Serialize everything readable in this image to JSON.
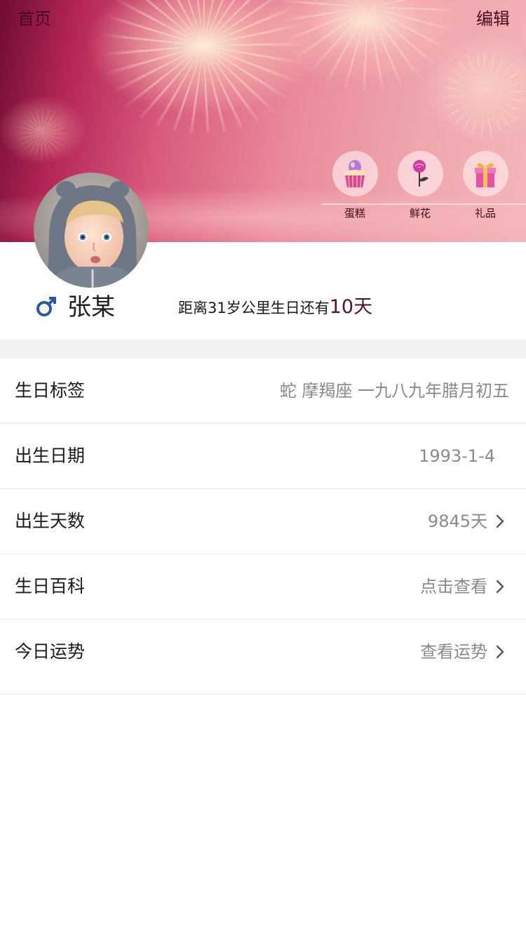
{
  "header": {
    "home_label": "首页",
    "edit_label": "编辑"
  },
  "gifts": [
    {
      "label": "蛋糕",
      "icon": "cupcake-icon"
    },
    {
      "label": "鲜花",
      "icon": "rose-icon"
    },
    {
      "label": "礼品",
      "icon": "gift-box-icon"
    }
  ],
  "profile": {
    "avatar": "child-avatar-photo",
    "gender_icon": "male-symbol-icon",
    "name": "张某",
    "countdown_prefix": "距离31岁公里生日还有",
    "countdown_days": "10天"
  },
  "info_rows": [
    {
      "label": "生日标签",
      "value": "蛇 摩羯座 一九八九年腊月初五"
    },
    {
      "label": "出生日期",
      "value": "1993-1-4"
    },
    {
      "label": "出生天数",
      "value": "9845天"
    },
    {
      "label": "生日百科",
      "value": "点击查看"
    },
    {
      "label": "今日运势",
      "value": "查看运势"
    }
  ],
  "colors": {
    "banner_dark": "#6e0c33",
    "banner_light": "#f3b6b8",
    "countdown_accent": "#5a0f29",
    "male_icon": "#2a5a9e",
    "value_gray": "#8a8a8a"
  }
}
